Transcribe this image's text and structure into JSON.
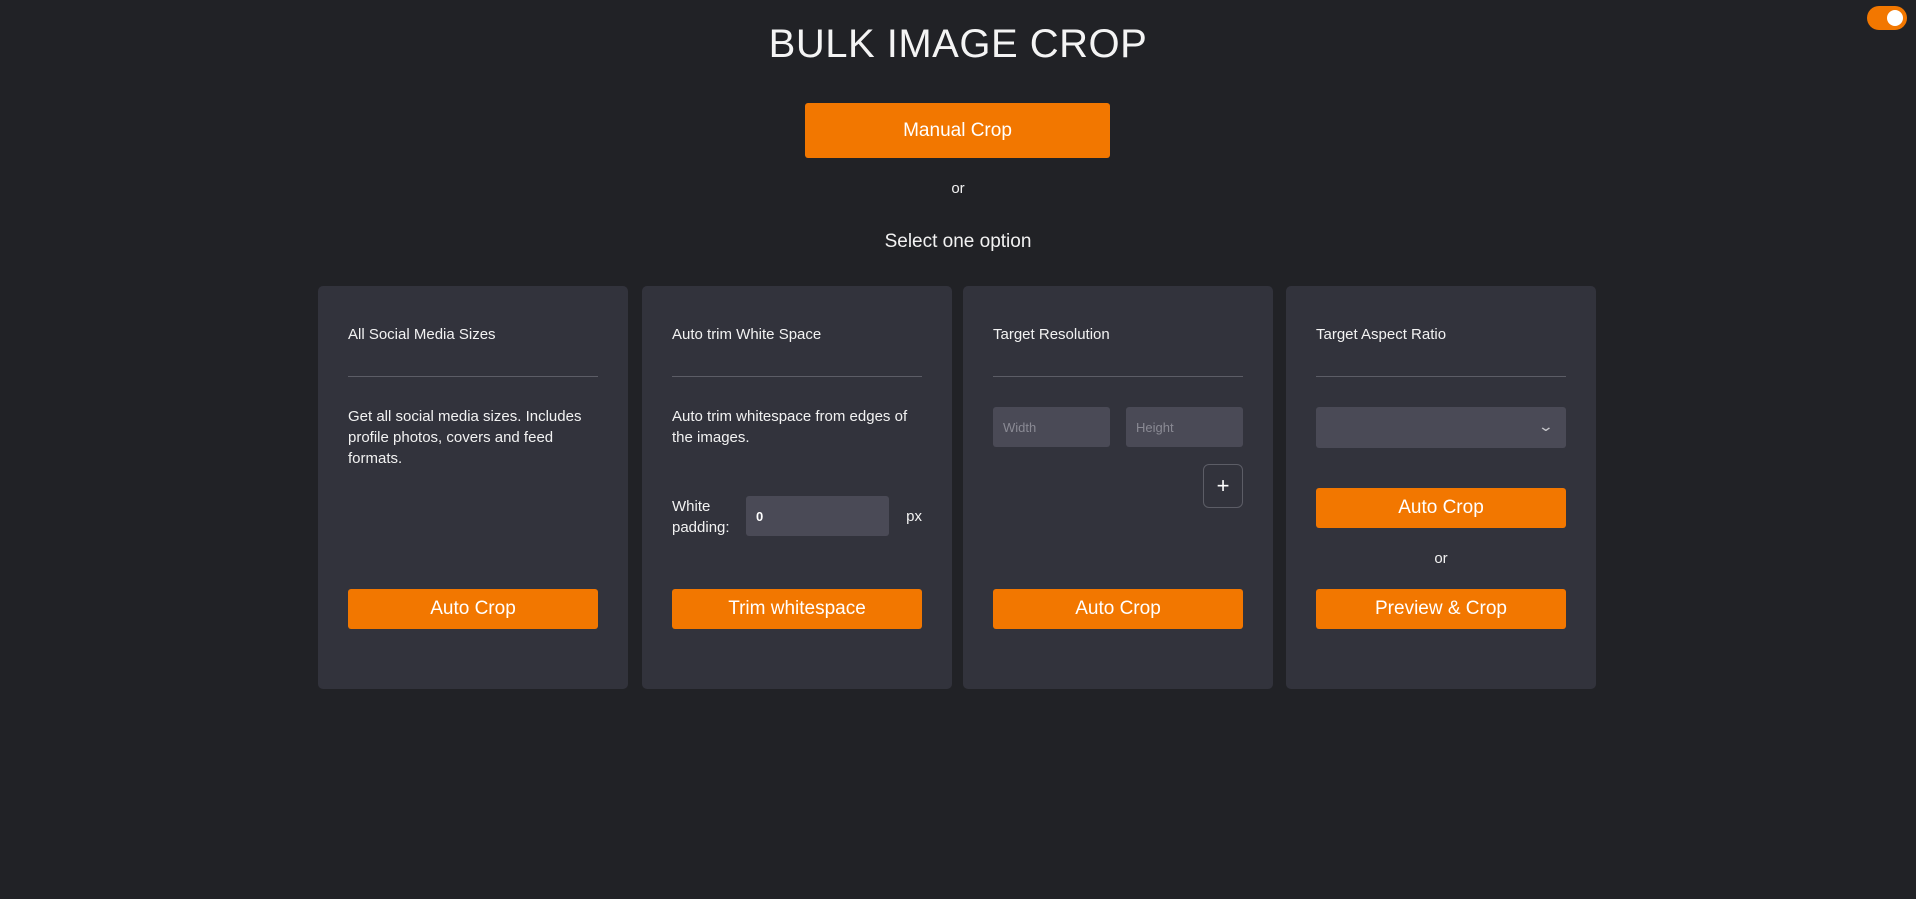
{
  "header": {
    "title": "BULK IMAGE CROP",
    "manual_crop": "Manual Crop",
    "or": "or",
    "select_option": "Select one option",
    "theme_toggle_on": true
  },
  "cards": [
    {
      "title": "All Social Media Sizes",
      "description": "Get all social media sizes. Includes profile photos, covers and feed formats.",
      "button": "Auto Crop"
    },
    {
      "title": "Auto trim White Space",
      "description": "Auto trim whitespace from edges of the images.",
      "padding_label": "White padding:",
      "padding_value": "0",
      "padding_unit": "px",
      "button": "Trim whitespace"
    },
    {
      "title": "Target Resolution",
      "width_placeholder": "Width",
      "height_placeholder": "Height",
      "add_label": "+",
      "button": "Auto Crop"
    },
    {
      "title": "Target Aspect Ratio",
      "select_value": "",
      "auto_button": "Auto Crop",
      "or": "or",
      "preview_button": "Preview & Crop"
    }
  ],
  "colors": {
    "accent": "#f27700",
    "background": "#212226",
    "card": "#32333c"
  }
}
